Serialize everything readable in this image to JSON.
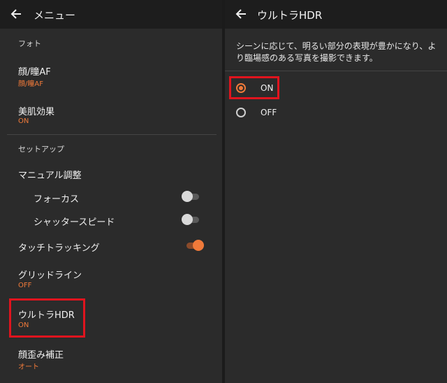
{
  "left": {
    "title": "メニュー",
    "section_photo": "フォト",
    "face_eye_af": {
      "label": "顔/瞳AF",
      "value": "顔/瞳AF"
    },
    "skin_effect": {
      "label": "美肌効果",
      "value": "ON"
    },
    "section_setup": "セットアップ",
    "manual_adjust": "マニュアル調整",
    "focus": {
      "label": "フォーカス",
      "state": "off"
    },
    "shutter_speed": {
      "label": "シャッタースピード",
      "state": "off"
    },
    "touch_tracking": {
      "label": "タッチトラッキング",
      "state": "on"
    },
    "grid_line": {
      "label": "グリッドライン",
      "value": "OFF"
    },
    "ultra_hdr": {
      "label": "ウルトラHDR",
      "value": "ON"
    },
    "face_distortion": {
      "label": "顔歪み補正",
      "value": "オート"
    }
  },
  "right": {
    "title": "ウルトラHDR",
    "description": "シーンに応じて、明るい部分の表現が豊かになり、より臨場感のある写真を撮影できます。",
    "options": [
      {
        "label": "ON",
        "selected": true
      },
      {
        "label": "OFF",
        "selected": false
      }
    ]
  },
  "colors": {
    "accent": "#f07a3a",
    "highlight": "#e0141e",
    "background": "#2b2b2b",
    "topbar": "#1d1d1d"
  }
}
